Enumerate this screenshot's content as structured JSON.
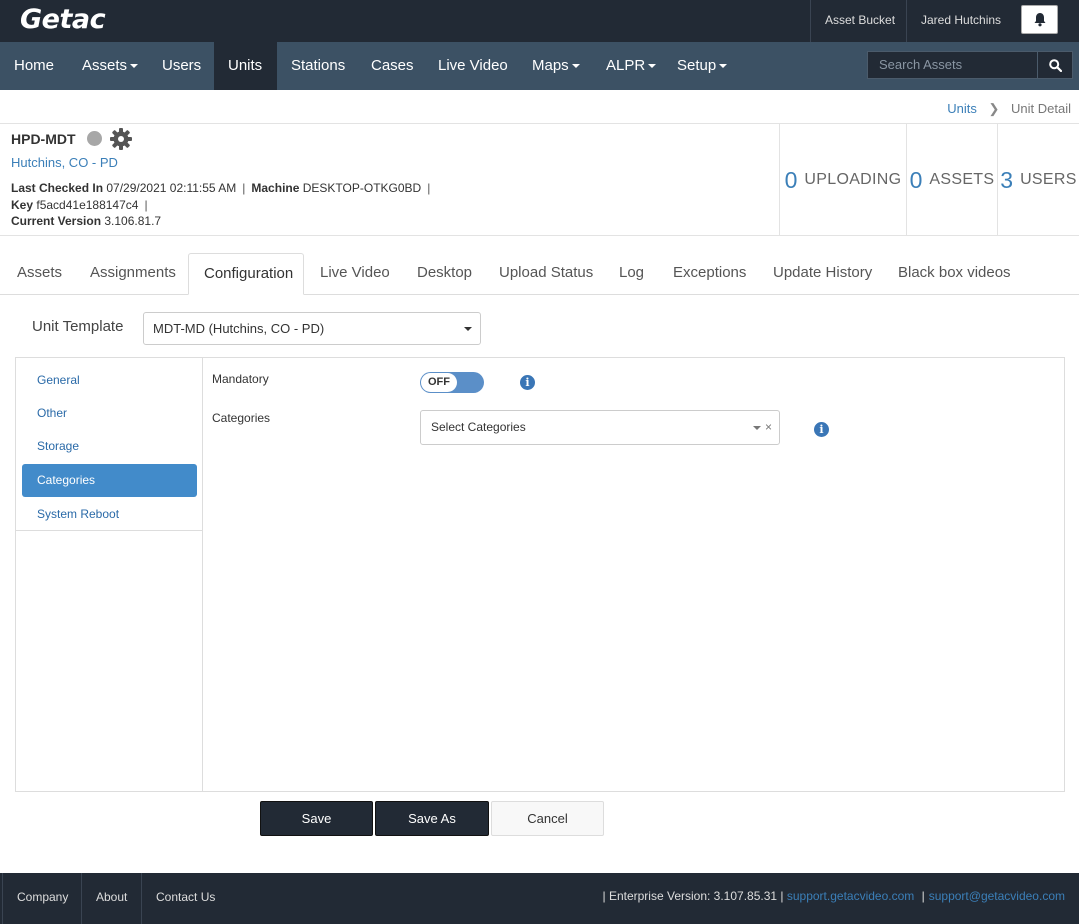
{
  "app": {
    "logo": "Getac"
  },
  "topbar": {
    "asset_bucket": "Asset Bucket",
    "user_name": "Jared Hutchins"
  },
  "nav": {
    "items": [
      {
        "label": "Home"
      },
      {
        "label": "Assets"
      },
      {
        "label": "Users"
      },
      {
        "label": "Units"
      },
      {
        "label": "Stations"
      },
      {
        "label": "Cases"
      },
      {
        "label": "Live Video"
      },
      {
        "label": "Maps"
      },
      {
        "label": "ALPR"
      },
      {
        "label": "Setup"
      }
    ],
    "active": "Units",
    "search_placeholder": "Search Assets"
  },
  "breadcrumb": {
    "parent": "Units",
    "current": "Unit Detail"
  },
  "unit": {
    "name": "HPD-MDT",
    "location": "Hutchins, CO - PD",
    "last_checked_label": "Last Checked In",
    "last_checked_value": "07/29/2021 02:11:55 AM",
    "machine_label": "Machine",
    "machine_value": "DESKTOP-OTKG0BD",
    "key_label": "Key",
    "key_value": "f5acd41e188147c4",
    "version_label": "Current Version",
    "version_value": "3.106.81.7"
  },
  "stats": [
    {
      "num": "0",
      "label": "UPLOADING"
    },
    {
      "num": "0",
      "label": "ASSETS"
    },
    {
      "num": "3",
      "label": "USERS"
    }
  ],
  "tabs": [
    {
      "label": "Assets"
    },
    {
      "label": "Assignments"
    },
    {
      "label": "Configuration"
    },
    {
      "label": "Live Video"
    },
    {
      "label": "Desktop"
    },
    {
      "label": "Upload Status"
    },
    {
      "label": "Log"
    },
    {
      "label": "Exceptions"
    },
    {
      "label": "Update History"
    },
    {
      "label": "Black box videos"
    }
  ],
  "active_tab": "Configuration",
  "template": {
    "label": "Unit Template",
    "value": "MDT-MD (Hutchins, CO - PD)"
  },
  "side_menu": [
    {
      "label": "General"
    },
    {
      "label": "Other"
    },
    {
      "label": "Storage"
    },
    {
      "label": "Categories"
    },
    {
      "label": "System Reboot"
    }
  ],
  "active_side": "Categories",
  "form": {
    "mandatory_label": "Mandatory",
    "mandatory_state": "OFF",
    "categories_label": "Categories",
    "categories_placeholder": "Select Categories",
    "clear_symbol": "×"
  },
  "buttons": {
    "save": "Save",
    "save_as": "Save As",
    "cancel": "Cancel"
  },
  "footer": {
    "company": "Company",
    "about": "About",
    "contact": "Contact Us",
    "version": "| Enterprise Version: 3.107.85.31 |",
    "support_site": "support.getacvideo.com",
    "sep": "|",
    "support_email": "support@getacvideo.com"
  },
  "colors": {
    "topbar": "#222a35",
    "navbar": "#3c5164",
    "accent": "#428bca",
    "link": "#3b7fb8"
  }
}
